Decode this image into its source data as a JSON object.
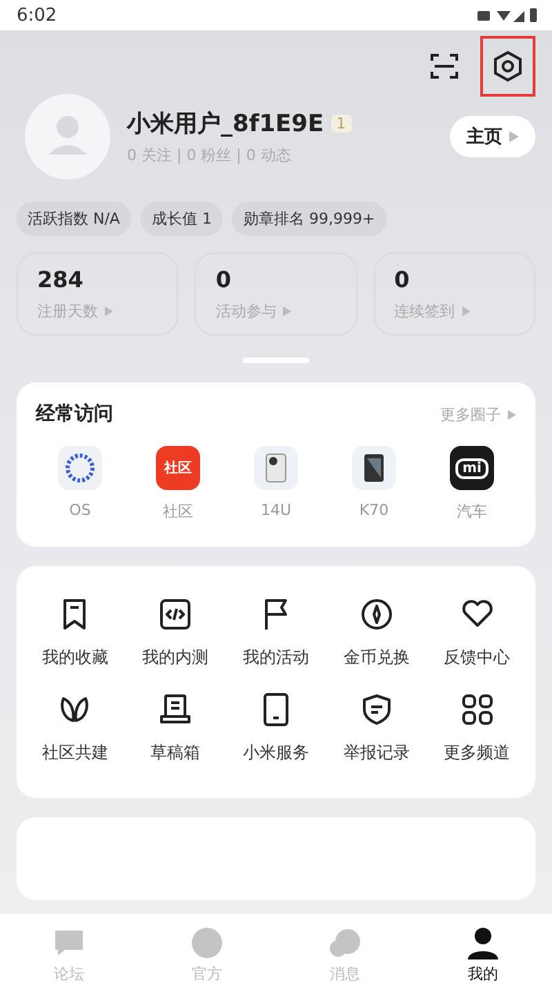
{
  "status_bar": {
    "time": "6:02"
  },
  "top_actions": [
    {
      "kind": "scan",
      "highlighted": false
    },
    {
      "kind": "settings",
      "highlighted": true
    }
  ],
  "profile": {
    "name": "小米用户_8f1E9E",
    "level": "1",
    "stats_line": "0 关注 | 0 粉丝 | 0 动态",
    "home_button": "主页"
  },
  "chips": [
    "活跃指数 N/A",
    "成长值 1",
    "勋章排名 99,999+"
  ],
  "stat_cards": [
    {
      "value": "284",
      "label": "注册天数"
    },
    {
      "value": "0",
      "label": "活动参与"
    },
    {
      "value": "0",
      "label": "连续签到"
    }
  ],
  "frequent": {
    "title": "经常访问",
    "more": "更多圈子",
    "items": [
      {
        "kind": "os",
        "label": "OS"
      },
      {
        "kind": "community",
        "label": "社区",
        "icon_text": "社区"
      },
      {
        "kind": "phone_white",
        "label": "14U"
      },
      {
        "kind": "phone_dark",
        "label": "K70"
      },
      {
        "kind": "car",
        "label": "汽车",
        "icon_text": "mi"
      }
    ]
  },
  "services": [
    {
      "kind": "bookmark",
      "label": "我的收藏"
    },
    {
      "kind": "code",
      "label": "我的内测"
    },
    {
      "kind": "flag",
      "label": "我的活动"
    },
    {
      "kind": "coin",
      "label": "金币兑换"
    },
    {
      "kind": "heart",
      "label": "反馈中心"
    },
    {
      "kind": "leaf",
      "label": "社区共建"
    },
    {
      "kind": "draft",
      "label": "草稿箱"
    },
    {
      "kind": "tablet",
      "label": "小米服务"
    },
    {
      "kind": "shield",
      "label": "举报记录"
    },
    {
      "kind": "grid",
      "label": "更多频道"
    }
  ],
  "bottom_nav": [
    {
      "kind": "forum",
      "label": "论坛",
      "selected": false
    },
    {
      "kind": "official",
      "label": "官方",
      "selected": false
    },
    {
      "kind": "message",
      "label": "消息",
      "selected": false
    },
    {
      "kind": "me",
      "label": "我的",
      "selected": true
    }
  ]
}
